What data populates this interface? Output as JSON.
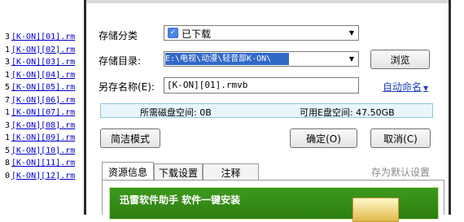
{
  "file_list": [
    {
      "num": "3",
      "name": "[K-ON][01].rm"
    },
    {
      "num": "1",
      "name": "[K-ON][02].rm"
    },
    {
      "num": "3",
      "name": "[K-ON][03].rm"
    },
    {
      "num": "1",
      "name": "[K-ON][04].rm"
    },
    {
      "num": "5",
      "name": "[K-ON][05].rm"
    },
    {
      "num": "7",
      "name": "[K-ON][06].rm"
    },
    {
      "num": "1",
      "name": "[K-ON][07].rm"
    },
    {
      "num": "3",
      "name": "[K-ON][08].rm"
    },
    {
      "num": "1",
      "name": "[K-ON][09].rm"
    },
    {
      "num": "5",
      "name": "[K-ON][10].rm"
    },
    {
      "num": "8",
      "name": "[K-ON][11].rm"
    },
    {
      "num": "0",
      "name": "[K-ON][12].rm"
    }
  ],
  "dialog": {
    "category_label": "存储分类",
    "category_value": "已下载",
    "directory_label": "存储目录:",
    "directory_value": "E:\\电视\\动漫\\轻音部K-ON\\",
    "browse_button": "浏览",
    "saveas_label": "另存名称(E):",
    "saveas_value": "[K-ON][01].rmvb",
    "auto_name": "自动命名",
    "space_required": "所需磁盘空间: 0B",
    "space_available": "可用E盘空间: 47.50GB",
    "simple_mode_button": "简洁模式",
    "ok_button": "确定(O)",
    "cancel_button": "取消(C)",
    "tabs": [
      "资源信息",
      "下载设置",
      "注释"
    ],
    "set_default": "存为默认设置",
    "banner_text": "迅雷软件助手  软件一键安装"
  }
}
